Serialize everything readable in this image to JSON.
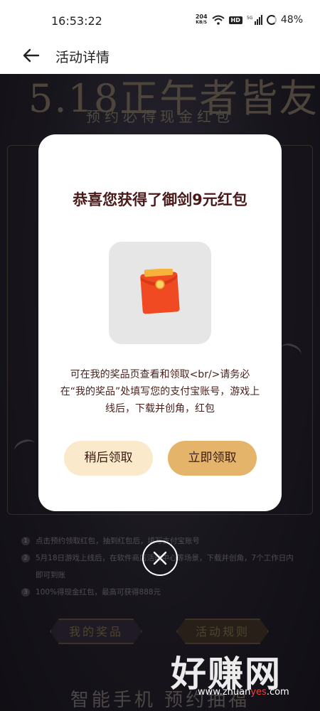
{
  "status_bar": {
    "time": "16:53:22",
    "net_speed_value": "204",
    "net_speed_unit": "KB/S",
    "hd_badge": "HD",
    "signal_label": "5G",
    "battery": "48%"
  },
  "nav": {
    "title": "活动详情",
    "back_icon": "arrow-left-icon"
  },
  "background": {
    "headline": "5.18正午者皆友",
    "subtitle": "预约必得现金红包",
    "rules": [
      {
        "num": "1",
        "text": "点击预约领取红包，抽到红包后，填写支付宝账号"
      },
      {
        "num": "2",
        "text": "5月18日游戏上线后，在软件商店活动中心等场景，下载并创角，7个工作日内即可到账"
      },
      {
        "num": "3",
        "text": "100%得现金红包，最高可获得888元"
      }
    ],
    "prizes_button": "我的奖品",
    "rules_button": "活动规则",
    "footer_text": "智能手机 预约抽福"
  },
  "modal": {
    "title": "恭喜您获得了御剑9元红包",
    "reward_icon": "red-envelope-icon",
    "description": "可在我的奖品页查看和领取<br/>请务必在“我的奖品”处填写您的支付宝账号，游戏上线后，下载并创角，红包",
    "later_button": "稍后领取",
    "claim_button": "立即领取",
    "close_icon": "close-icon"
  },
  "watermark": {
    "logo_text": "好赚网",
    "url_prefix": "www.zhuan",
    "url_highlight": "yes",
    "url_suffix": ".com"
  },
  "colors": {
    "modal_title": "#4a1a1a",
    "later_button_bg": "#fbe9cc",
    "claim_button_bg": "#e3b46a",
    "envelope": "#f04a22"
  }
}
